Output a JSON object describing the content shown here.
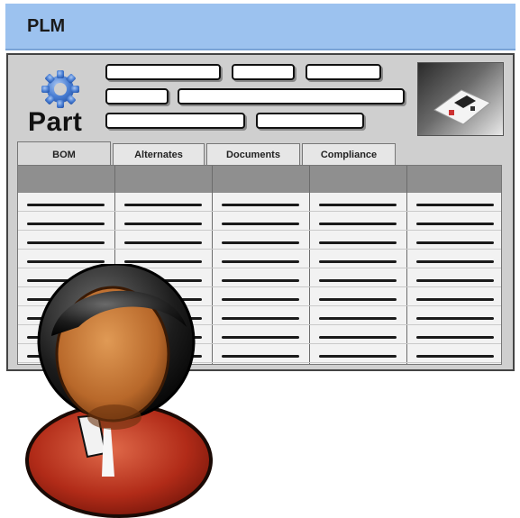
{
  "app": {
    "title": "PLM"
  },
  "part": {
    "label": "Part"
  },
  "tabs": [
    {
      "label": "BOM",
      "active": true
    },
    {
      "label": "Alternates",
      "active": false
    },
    {
      "label": "Documents",
      "active": false
    },
    {
      "label": "Compliance",
      "active": false
    }
  ],
  "icons": {
    "gear": "gear-icon",
    "thumbnail": "part-image",
    "user": "user-avatar-icon"
  },
  "colors": {
    "titlebar": "#9cc2ef",
    "window": "#cfcfcf",
    "grid_header": "#8f8f8f",
    "gear": "#4a7fd4"
  }
}
